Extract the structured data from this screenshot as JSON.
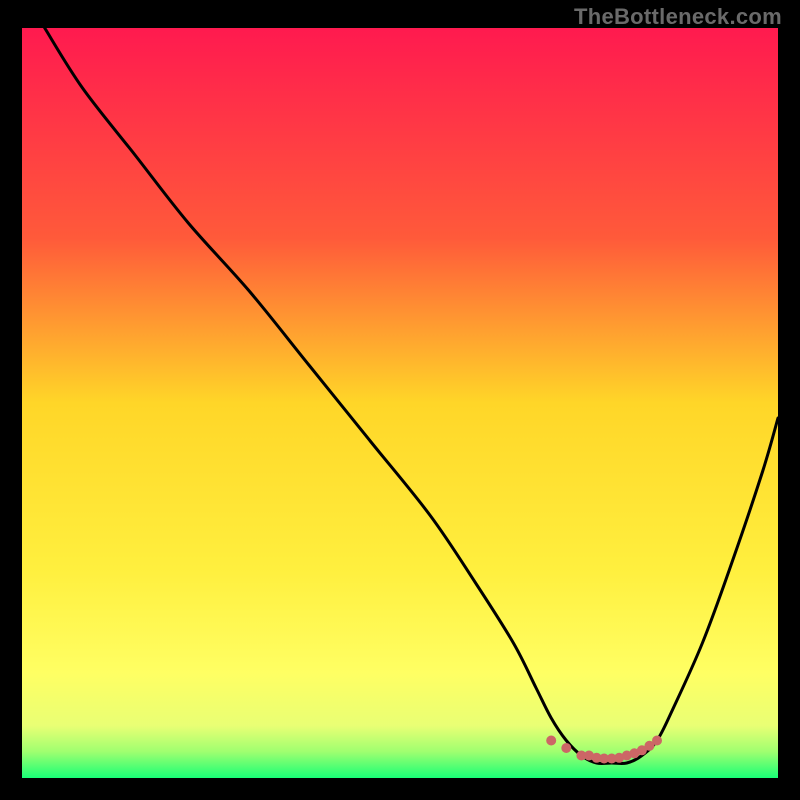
{
  "watermark": "TheBottleneck.com",
  "colors": {
    "gradient_top": "#ff1a4f",
    "gradient_mid_upper": "#ff7a2e",
    "gradient_mid": "#ffd628",
    "gradient_low": "#ffff63",
    "gradient_bottom_yellow": "#e9ff74",
    "gradient_bottom_green": "#19ff76",
    "line": "#000000",
    "marker": "#cc6666"
  },
  "chart_data": {
    "type": "line",
    "title": "",
    "xlabel": "",
    "ylabel": "",
    "xlim": [
      0,
      100
    ],
    "ylim": [
      0,
      100
    ],
    "series": [
      {
        "name": "bottleneck-curve",
        "x": [
          3,
          8,
          15,
          22,
          30,
          38,
          46,
          54,
          60,
          65,
          68,
          70,
          72,
          74,
          76,
          78,
          80,
          82,
          84,
          86,
          90,
          94,
          98,
          100
        ],
        "y": [
          100,
          92,
          83,
          74,
          65,
          55,
          45,
          35,
          26,
          18,
          12,
          8,
          5,
          3,
          2,
          2,
          2,
          3,
          5,
          9,
          18,
          29,
          41,
          48
        ]
      }
    ],
    "markers": {
      "name": "highlight-region",
      "x": [
        70,
        72,
        74,
        75,
        76,
        77,
        78,
        79,
        80,
        81,
        82,
        83,
        84
      ],
      "y": [
        5,
        4,
        3,
        3,
        2.7,
        2.6,
        2.6,
        2.7,
        3,
        3.3,
        3.7,
        4.3,
        5
      ]
    }
  }
}
